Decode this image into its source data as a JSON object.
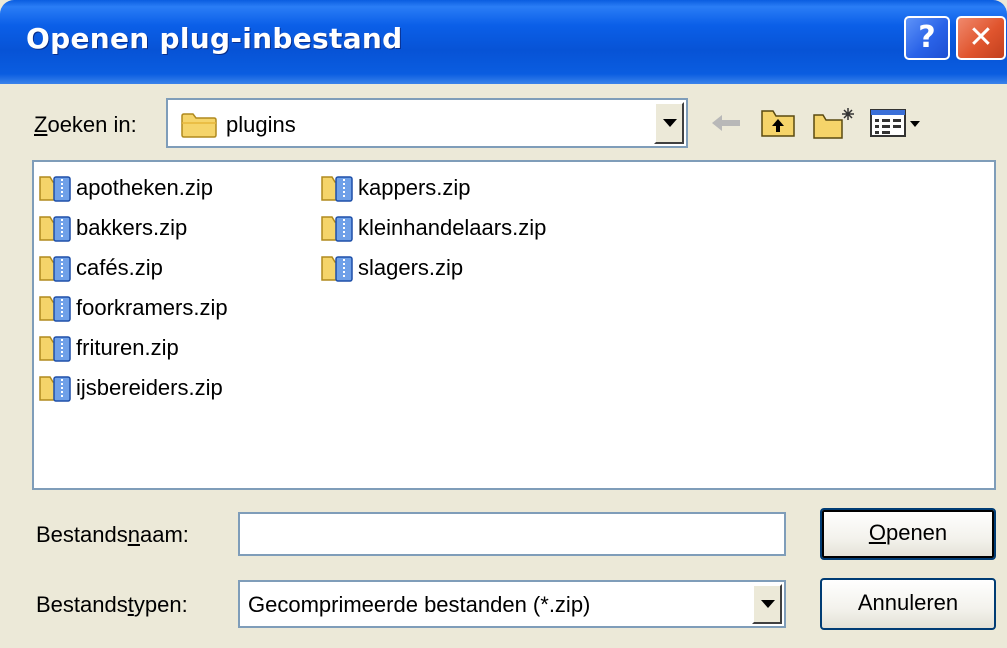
{
  "window": {
    "title": "Openen plug-inbestand",
    "help_glyph": "?",
    "close_glyph": "✕"
  },
  "lookin": {
    "label_prefix": "",
    "label_mnemonic": "Z",
    "label_rest": "oeken in:",
    "value": "plugins"
  },
  "files": [
    {
      "name": "apotheken.zip"
    },
    {
      "name": "bakkers.zip"
    },
    {
      "name": "cafés.zip"
    },
    {
      "name": "foorkramers.zip"
    },
    {
      "name": "frituren.zip"
    },
    {
      "name": "ijsbereiders.zip"
    },
    {
      "name": "kappers.zip"
    },
    {
      "name": "kleinhandelaars.zip"
    },
    {
      "name": "slagers.zip"
    }
  ],
  "filename": {
    "label_prefix": "Bestands",
    "label_mnemonic": "n",
    "label_rest": "aam:",
    "value": "",
    "placeholder": ""
  },
  "filetype": {
    "label_prefix": "Bestands",
    "label_mnemonic": "t",
    "label_rest": "ypen:",
    "value": "Gecomprimeerde bestanden (*.zip)"
  },
  "buttons": {
    "open_mnemonic": "O",
    "open_rest": "penen",
    "cancel": "Annuleren"
  },
  "icons": {
    "folder": "folder-icon",
    "zip": "zip-folder-icon",
    "back": "back-arrow-icon",
    "up": "up-folder-icon",
    "new_folder": "new-folder-icon",
    "views": "views-menu-icon"
  },
  "colors": {
    "titlebar": "#0A5DE0",
    "dialog_bg": "#ECE9D8",
    "field_border": "#7F9DB9",
    "button_border": "#003C74"
  }
}
